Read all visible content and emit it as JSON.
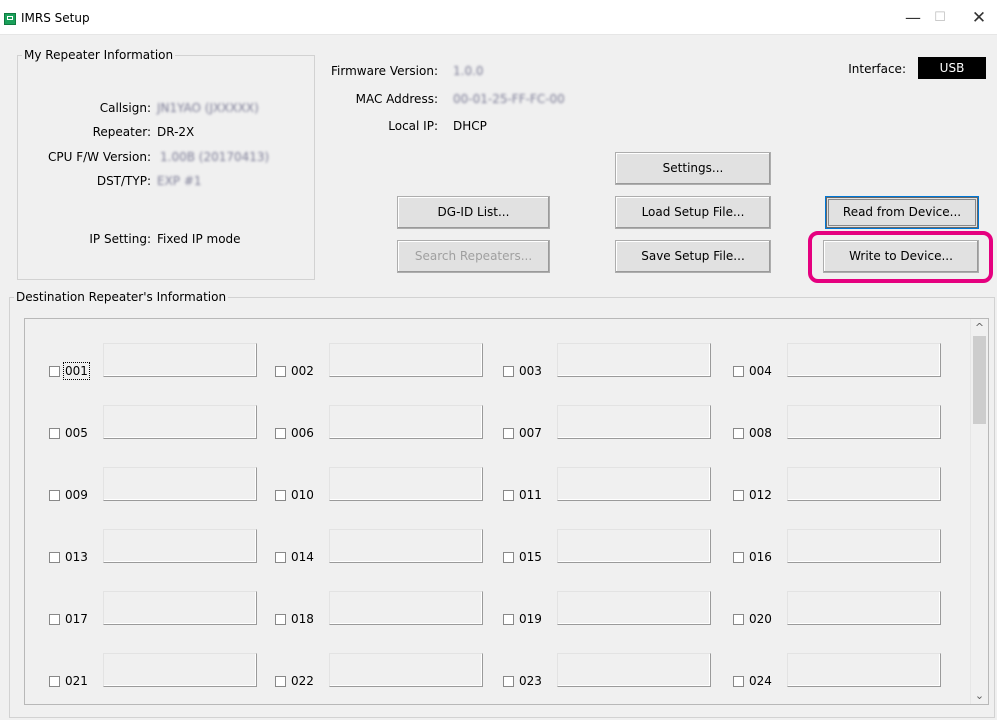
{
  "window": {
    "title": "IMRS Setup",
    "minimize": "—",
    "maximize": "☐",
    "close": "✕"
  },
  "my_repeater": {
    "legend": "My Repeater Information",
    "callsign_label": "Callsign:",
    "callsign_value": "JN1YAO (JXXXXX)",
    "repeater_label": "Repeater:",
    "repeater_value": "DR-2X",
    "cpu_label": "CPU F/W Version:",
    "cpu_value": "1.00B (20170413)",
    "dst_label": "DST/TYP:",
    "dst_value": "EXP #1",
    "ip_setting_label": "IP Setting:",
    "ip_setting_value": "Fixed IP mode"
  },
  "info": {
    "firmware_label": "Firmware Version:",
    "firmware_value": "1.0.0",
    "mac_label": "MAC Address:",
    "mac_value": "00-01-25-FF-FC-00",
    "local_ip_label": "Local IP:",
    "local_ip_value": "DHCP",
    "interface_label": "Interface:",
    "interface_value": "USB"
  },
  "buttons": {
    "settings": "Settings...",
    "dgid_list": "DG-ID List...",
    "load_setup": "Load Setup File...",
    "read_device": "Read from Device...",
    "search_repeaters": "Search Repeaters...",
    "save_setup": "Save Setup File...",
    "write_device": "Write to Device..."
  },
  "destination": {
    "legend": "Destination Repeater's Information",
    "slots": [
      "001",
      "002",
      "003",
      "004",
      "005",
      "006",
      "007",
      "008",
      "009",
      "010",
      "011",
      "012",
      "013",
      "014",
      "015",
      "016",
      "017",
      "018",
      "019",
      "020",
      "021",
      "022",
      "023",
      "024"
    ]
  },
  "scrollbar": {
    "up": "^",
    "down": "⌄"
  },
  "colors": {
    "highlight": "#e5007f",
    "badge_bg": "#000000"
  }
}
